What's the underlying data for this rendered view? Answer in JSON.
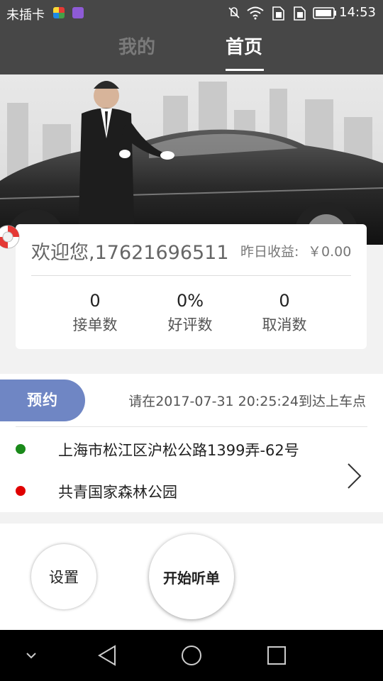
{
  "status_bar": {
    "carrier": "未插卡",
    "time": "14:53",
    "icons": [
      "app-icon-color",
      "app-icon-purple",
      "mute-icon",
      "wifi-icon",
      "sim-icon",
      "sim-icon",
      "battery-icon"
    ]
  },
  "tabs": [
    {
      "label": "我的",
      "active": false
    },
    {
      "label": "首页",
      "active": true
    }
  ],
  "welcome_card": {
    "greeting": "欢迎您,17621696511",
    "earnings_label": "昨日收益:",
    "earnings_value": "￥0.00",
    "stats": [
      {
        "value": "0",
        "label": "接单数"
      },
      {
        "value": "0%",
        "label": "好评数"
      },
      {
        "value": "0",
        "label": "取消数"
      }
    ]
  },
  "order": {
    "tag": "预约",
    "hint": "请在2017-07-31 20:25:24到达上车点",
    "pickup": "上海市松江区沪松公路1399弄-62号",
    "dropoff": "共青国家森林公园",
    "pickup_color": "#1a8a1a",
    "dropoff_color": "#e00000"
  },
  "actions": {
    "settings": "设置",
    "start": "开始听单"
  },
  "colors": {
    "header_bg": "#474747",
    "tag_bg": "#6f86c4"
  }
}
